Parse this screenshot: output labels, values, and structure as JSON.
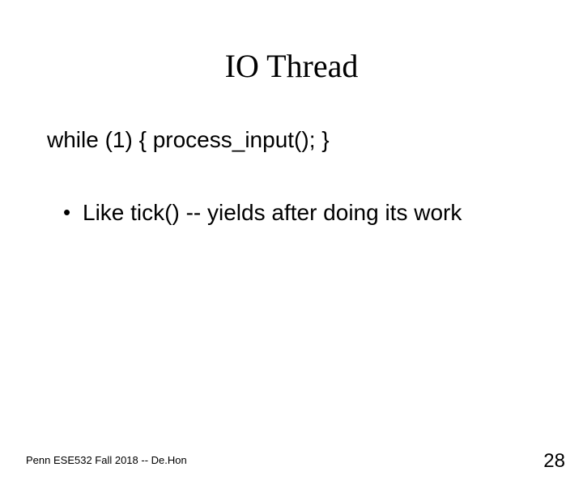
{
  "title": "IO Thread",
  "code_line": "while (1) { process_input(); }",
  "bullets": {
    "item0": "Like tick() -- yields after doing its work"
  },
  "footer": {
    "left": "Penn ESE532 Fall 2018 -- De.Hon",
    "page_number": "28"
  }
}
